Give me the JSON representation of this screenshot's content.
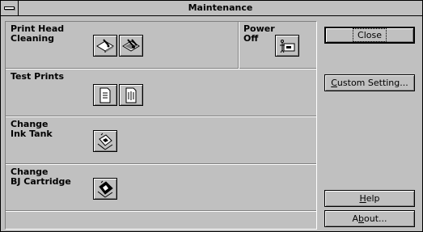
{
  "window": {
    "title": "Maintenance"
  },
  "sections": {
    "print_head_cleaning": {
      "label": "Print Head\nCleaning",
      "buttons": [
        {
          "icon": "cleaning-icon"
        },
        {
          "icon": "deep-cleaning-icon"
        }
      ]
    },
    "power_off": {
      "label": "Power\nOff",
      "button": {
        "icon": "power-off-icon"
      }
    },
    "test_prints": {
      "label": "Test Prints",
      "buttons": [
        {
          "icon": "test-print-page-icon"
        },
        {
          "icon": "nozzle-check-icon"
        }
      ]
    },
    "change_ink_tank": {
      "label": "Change\nInk Tank",
      "button": {
        "icon": "ink-tank-icon"
      }
    },
    "change_bj_cartridge": {
      "label": "Change\nBJ Cartridge",
      "button": {
        "icon": "bj-cartridge-icon"
      }
    }
  },
  "buttons": {
    "close": {
      "label": "Close"
    },
    "custom_setting": {
      "label_underlined": "C",
      "label_rest": "ustom Setting..."
    },
    "help": {
      "label_underlined": "H",
      "label_rest": "elp"
    },
    "about": {
      "label_pre": "A",
      "label_underlined": "b",
      "label_rest": "out..."
    }
  }
}
